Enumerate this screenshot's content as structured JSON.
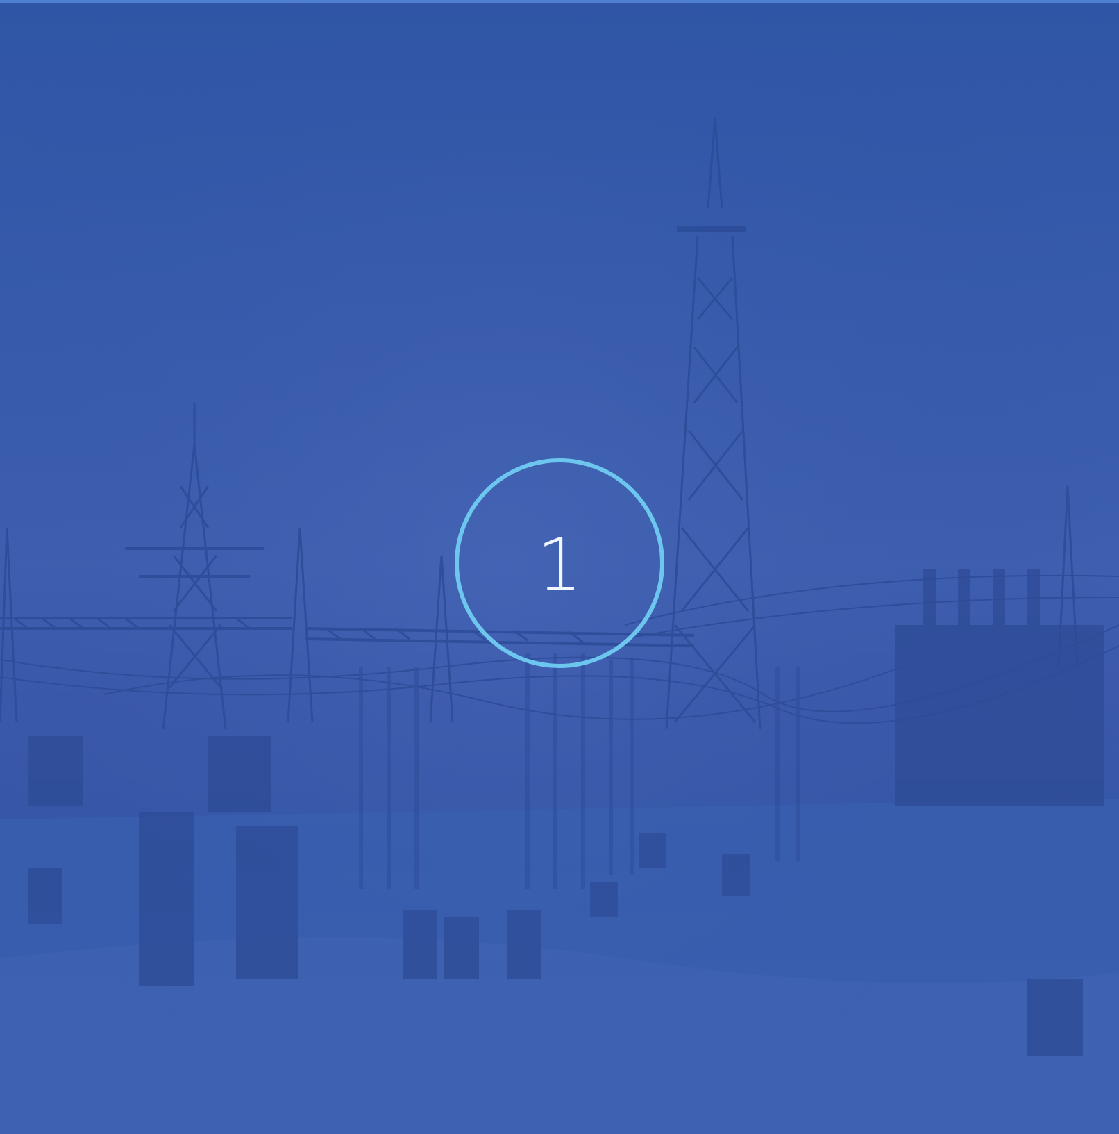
{
  "badge": {
    "number": "1"
  },
  "colors": {
    "overlay": "#3458a8",
    "ring": "#6cc6ee",
    "number": "#f2f6ff",
    "top_border": "#4f7fd0"
  },
  "image": {
    "subject": "electrical-substation-photo"
  }
}
